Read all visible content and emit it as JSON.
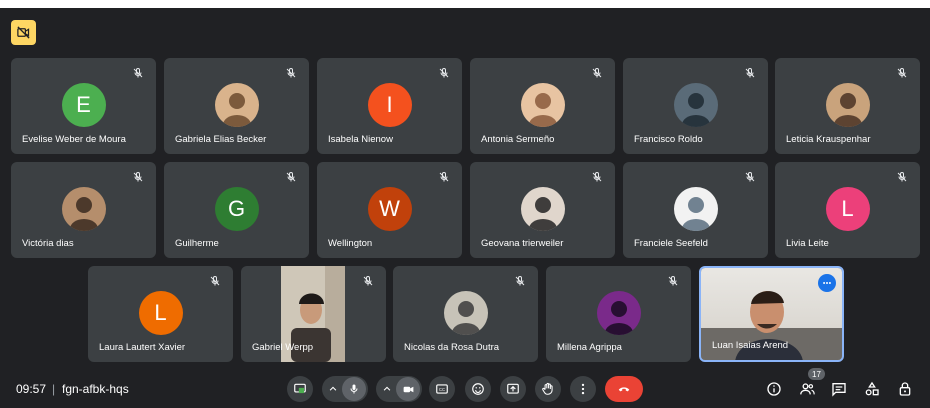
{
  "meeting": {
    "time": "09:57",
    "separator": "|",
    "code": "fgn-afbk-hqs",
    "participant_count": "17"
  },
  "tiles": [
    {
      "name": "Evelise Weber de Moura",
      "kind": "letter",
      "letter": "E",
      "color": "#4caf50"
    },
    {
      "name": "Gabriela Elias Becker",
      "kind": "photo"
    },
    {
      "name": "Isabela Nienow",
      "kind": "letter",
      "letter": "I",
      "color": "#f4511e"
    },
    {
      "name": "Antonia Sermeño",
      "kind": "photo"
    },
    {
      "name": "Francisco Roldo",
      "kind": "photo"
    },
    {
      "name": "Leticia Krauspenhar",
      "kind": "photo"
    },
    {
      "name": "Victória dias",
      "kind": "photo"
    },
    {
      "name": "Guilherme",
      "kind": "letter",
      "letter": "G",
      "color": "#2e7d32"
    },
    {
      "name": "Wellington",
      "kind": "letter",
      "letter": "W",
      "color": "#c1410b"
    },
    {
      "name": "Geovana trierweiler",
      "kind": "photo"
    },
    {
      "name": "Franciele Seefeld",
      "kind": "photo"
    },
    {
      "name": "Livia Leite",
      "kind": "letter",
      "letter": "L",
      "color": "#ec407a"
    },
    {
      "name": "Laura Lautert Xavier",
      "kind": "letter",
      "letter": "L",
      "color": "#ef6c00"
    },
    {
      "name": "Gabriel Werpp",
      "kind": "video-small"
    },
    {
      "name": "Nicolas da Rosa Dutra",
      "kind": "photo"
    },
    {
      "name": "Millena Agrippa",
      "kind": "photo"
    },
    {
      "name": "Luan Isaias Arend",
      "kind": "video"
    }
  ],
  "colors": {
    "background": "#202124",
    "tile": "#3c4043",
    "accent": "#8ab4f8",
    "end_call": "#ea4335"
  },
  "icons": {
    "top": "no-video-icon",
    "tile_mic": "mic-off-icon",
    "controls": [
      "screen-share-icon",
      "chevron-up-icon",
      "mic-icon",
      "chevron-up-icon",
      "camera-icon",
      "captions-icon",
      "emoji-icon",
      "present-icon",
      "raise-hand-icon",
      "more-options-icon",
      "end-call-icon"
    ],
    "right": [
      "info-icon",
      "people-icon",
      "chat-icon",
      "activities-icon",
      "host-controls-icon"
    ]
  }
}
